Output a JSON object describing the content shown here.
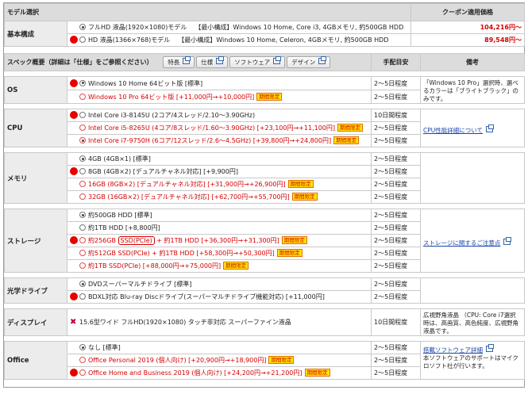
{
  "header": {
    "title": "モデル選択",
    "coupon_price": "クーポン適用価格"
  },
  "models": [
    {
      "label": "フルHD 液晶(1920×1080)モデル",
      "spec": "【最小構成】Windows 10 Home, Core i3, 4GBメモリ, 約500GB HDD",
      "price": "104,216円〜",
      "checked": true,
      "marked": false
    },
    {
      "label": "HD 液晶(1366×768)モデル",
      "spec": "【最小構成】Windows 10 Home, Celeron, 4GBメモリ, 約500GB HDD",
      "price": "89,548円〜",
      "checked": false,
      "marked": true
    }
  ],
  "model_label": "基本構成",
  "spec_header": {
    "title": "スペック概要（詳細は「仕様」をご参照ください）",
    "buttons": [
      "特長",
      "仕様",
      "ソフトウェア",
      "デザイン"
    ],
    "delivery": "手配目安",
    "remarks": "備考"
  },
  "badge_text": "期間限定",
  "groups": [
    {
      "label": "OS",
      "note": "「Windows 10 Pro」選択時、選べるカラーは「ブライトブラック」のみです。",
      "link": "",
      "options": [
        {
          "text": "Windows 10 Home 64ビット版 [標準]",
          "red": false,
          "checked": true,
          "marked": true,
          "badge": false,
          "delivery": "2〜5日程度"
        },
        {
          "text": "Windows 10 Pro 64ビット版 [+11,000円→+10,000円]",
          "red": true,
          "checked": false,
          "marked": false,
          "badge": true,
          "delivery": "2〜5日程度"
        }
      ]
    },
    {
      "label": "CPU",
      "note": "",
      "link": "CPU性能詳細について",
      "options": [
        {
          "text": "Intel Core i3-8145U (2コア/4スレッド/2.10〜3.90GHz)",
          "red": false,
          "checked": false,
          "marked": true,
          "badge": false,
          "delivery": "10日間程度"
        },
        {
          "text": "Intel Core i5-8265U (4コア/8スレッド/1.60〜3.90GHz) [+23,100円→+11,100円]",
          "red": true,
          "checked": false,
          "marked": false,
          "badge": true,
          "delivery": "2〜5日程度"
        },
        {
          "text": "Intel Core i7-9750H (6コア/12スレッド/2.6〜4.5GHz) [+39,800円→+24,800円]",
          "red": true,
          "checked": true,
          "marked": false,
          "badge": true,
          "delivery": "2〜5日程度"
        }
      ]
    },
    {
      "label": "メモリ",
      "note": "",
      "link": "",
      "options": [
        {
          "text": "4GB (4GB×1) [標準]",
          "red": false,
          "checked": true,
          "marked": false,
          "badge": false,
          "delivery": "2〜5日程度"
        },
        {
          "text": "8GB (4GB×2) [デュアルチャネル対応] [+9,900円]",
          "red": false,
          "checked": false,
          "marked": true,
          "badge": false,
          "delivery": "2〜5日程度"
        },
        {
          "text": "16GB (8GB×2) [デュアルチャネル対応] [+31,900円→+26,900円]",
          "red": true,
          "checked": false,
          "marked": false,
          "badge": true,
          "delivery": "2〜5日程度"
        },
        {
          "text": "32GB (16GB×2) [デュアルチャネル対応] [+62,700円→+55,700円]",
          "red": true,
          "checked": false,
          "marked": false,
          "badge": true,
          "delivery": "2〜5日程度"
        }
      ]
    },
    {
      "label": "ストレージ",
      "note": "",
      "link": "ストレージに関するご注意点",
      "options": [
        {
          "text": "約500GB HDD [標準]",
          "red": false,
          "checked": true,
          "marked": false,
          "badge": false,
          "delivery": "2〜5日程度"
        },
        {
          "text": "約1TB HDD [+8,800円]",
          "red": false,
          "checked": false,
          "marked": false,
          "badge": false,
          "delivery": "2〜5日程度"
        },
        {
          "pre": "約256GB ",
          "circled": "SSD(PCIe)",
          "post": " + 約1TB HDD [+36,300円→+31,300円]",
          "red": true,
          "checked": false,
          "marked": true,
          "badge": true,
          "delivery": "2〜5日程度"
        },
        {
          "text": "約512GB SSD(PCIe) + 約1TB HDD [+58,300円→+50,300円]",
          "red": true,
          "checked": false,
          "marked": false,
          "badge": true,
          "delivery": "2〜5日程度"
        },
        {
          "text": "約1TB SSD(PCIe) [+88,000円→+75,000円]",
          "red": true,
          "checked": false,
          "marked": false,
          "badge": true,
          "delivery": "2〜5日程度"
        }
      ]
    },
    {
      "label": "光学ドライブ",
      "note": "",
      "link": "",
      "options": [
        {
          "text": "DVDスーパーマルチドライブ [標準]",
          "red": false,
          "checked": true,
          "marked": false,
          "badge": false,
          "delivery": "2〜5日程度"
        },
        {
          "text": "BDXL対応 Blu-ray Discドライブ(スーパーマルチドライブ機能対応) [+11,000円]",
          "red": false,
          "checked": false,
          "marked": true,
          "badge": false,
          "delivery": "2〜5日程度"
        }
      ]
    },
    {
      "label": "ディスプレイ",
      "note": "広視野角液晶 （CPU: Core i7選択時は、高画質、高色純度、広視野角液晶です。",
      "link": "",
      "options": [
        {
          "text": "15.6型ワイド フルHD(1920×1080) タッチ非対応 スーパーファイン液晶",
          "red": false,
          "checked": false,
          "marked": false,
          "xmark": true,
          "badge": false,
          "delivery": "10日間程度"
        }
      ]
    },
    {
      "label": "Office",
      "note": "本ソフトウェアのサポートはマイクロソフト社が行います。",
      "link": "搭載ソフトウェア詳細",
      "options": [
        {
          "text": "なし [標準]",
          "red": false,
          "checked": true,
          "marked": false,
          "badge": false,
          "delivery": "2〜5日程度"
        },
        {
          "text": "Office Personal 2019 (個人向け) [+20,900円→+18,900円]",
          "red": true,
          "checked": false,
          "marked": false,
          "badge": true,
          "delivery": "2〜5日程度"
        },
        {
          "text": "Office Home and Business 2019 (個人向け) [+24,200円→+21,200円]",
          "red": true,
          "checked": false,
          "marked": true,
          "badge": true,
          "delivery": "2〜5日程度"
        }
      ]
    }
  ]
}
